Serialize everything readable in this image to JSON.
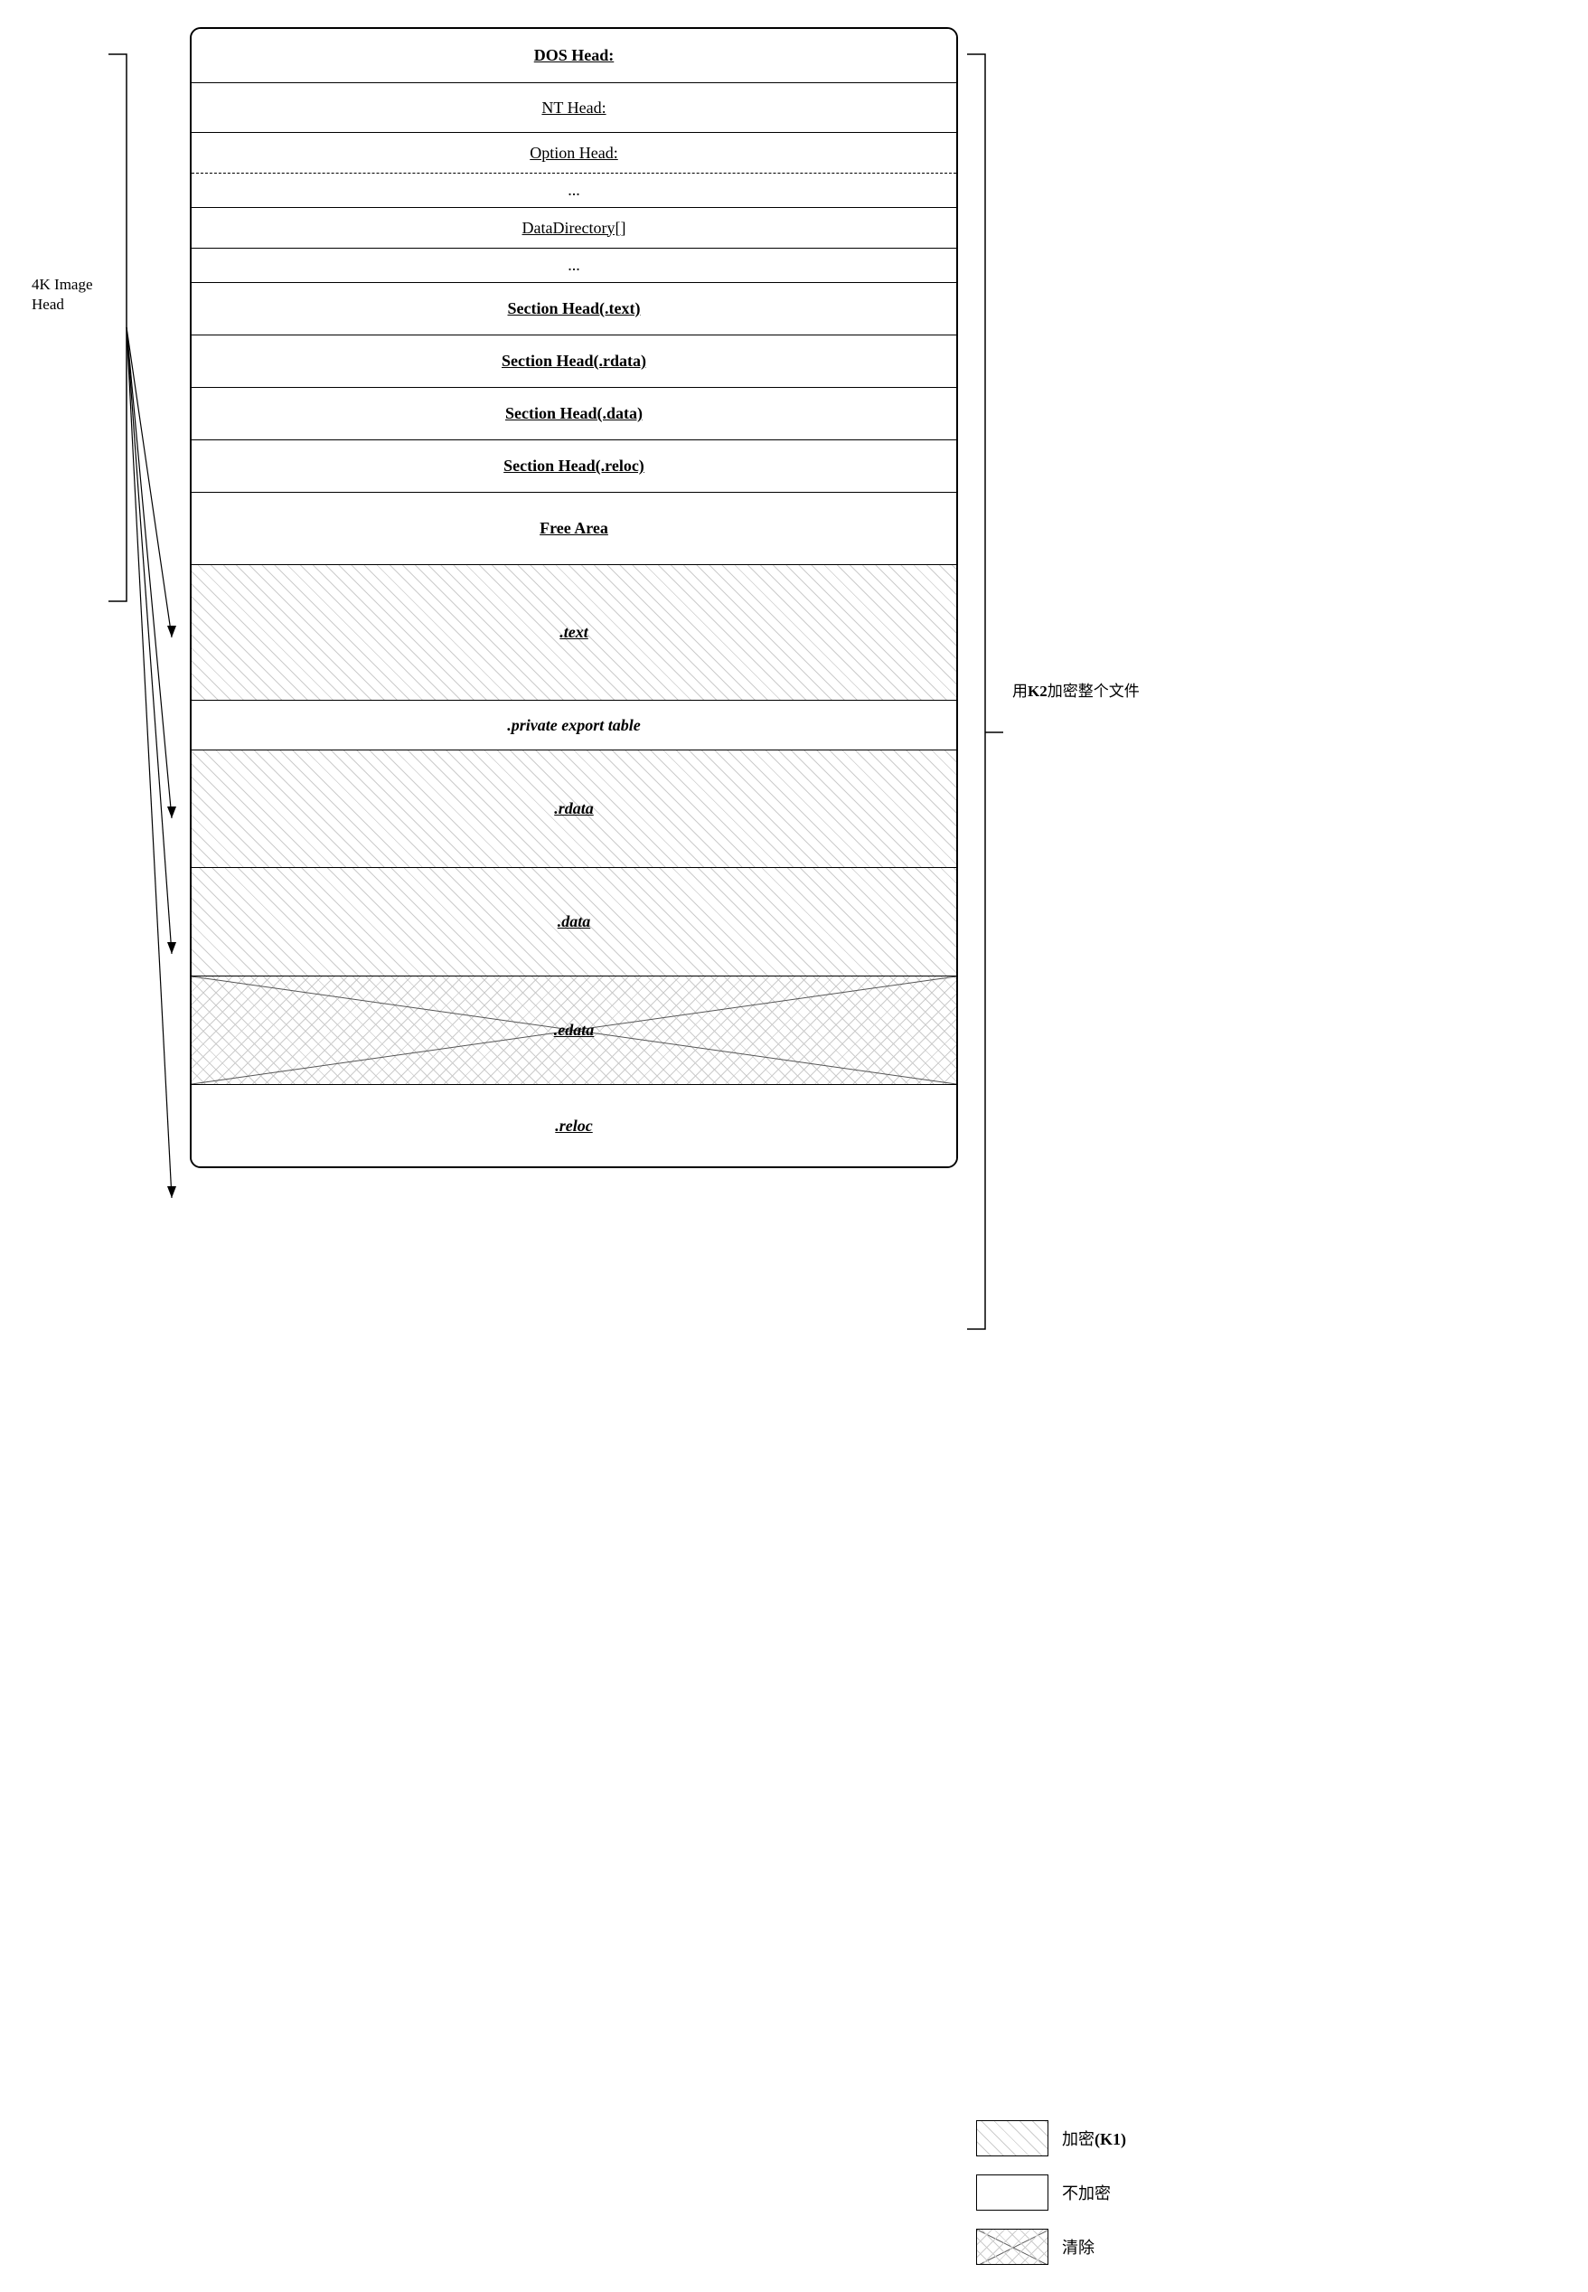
{
  "diagram": {
    "sections": [
      {
        "id": "dos-head",
        "text": "DOS Head:",
        "style": "bold-underline",
        "height": "h-dos",
        "hatched": false
      },
      {
        "id": "nt-head",
        "text": "NT Head:",
        "style": "normal-underline",
        "height": "h-nt",
        "hatched": false,
        "dashed_bottom": false
      },
      {
        "id": "option-head",
        "text": "Option Head:",
        "style": "normal-underline",
        "height": "h-option",
        "hatched": false,
        "dashed_bottom": true
      },
      {
        "id": "dots1",
        "text": "...",
        "style": "normal",
        "height": "h-dots",
        "hatched": false
      },
      {
        "id": "datadir",
        "text": "DataDirectory[]",
        "style": "normal-underline",
        "height": "h-datadir",
        "hatched": false
      },
      {
        "id": "dots2",
        "text": "...",
        "style": "normal",
        "height": "h-dots2",
        "hatched": false
      },
      {
        "id": "sec-text",
        "text": "Section Head(.text)",
        "style": "bold-underline",
        "height": "h-sechead",
        "hatched": false
      },
      {
        "id": "sec-rdata",
        "text": "Section Head(.rdata)",
        "style": "bold-underline",
        "height": "h-sechead",
        "hatched": false
      },
      {
        "id": "sec-data",
        "text": "Section Head(.data)",
        "style": "bold-underline",
        "height": "h-sechead",
        "hatched": false
      },
      {
        "id": "sec-reloc",
        "text": "Section Head(.reloc)",
        "style": "bold-underline",
        "height": "h-sechead",
        "hatched": false
      },
      {
        "id": "free-area",
        "text": "Free Area",
        "style": "bold-underline",
        "height": "h-free",
        "hatched": false
      },
      {
        "id": "text-section",
        "text": ".text",
        "style": "bold-italic-underline",
        "height": "h-text",
        "hatched": true
      },
      {
        "id": "private-export",
        "text": ".private export table",
        "style": "bold-italic",
        "height": "h-private",
        "hatched": false
      },
      {
        "id": "rdata-section",
        "text": ".rdata",
        "style": "bold-italic-underline",
        "height": "h-rdata",
        "hatched": true
      },
      {
        "id": "data-section",
        "text": ".data",
        "style": "bold-italic-underline",
        "height": "h-data",
        "hatched": true
      },
      {
        "id": "edata-section",
        "text": ".edata",
        "style": "bold-italic-underline",
        "height": "h-edata",
        "hatched": false,
        "cross_hatched": true
      },
      {
        "id": "reloc-section",
        "text": ".reloc",
        "style": "bold-italic-underline",
        "height": "h-reloc",
        "hatched": false
      }
    ],
    "left_label": "4K Image\nHead",
    "right_label_k2": "用K2加密整个文件",
    "legend": [
      {
        "type": "hatched",
        "label": "加密(K1)"
      },
      {
        "type": "plain",
        "label": "不加密"
      },
      {
        "type": "cross",
        "label": "清除"
      }
    ]
  }
}
